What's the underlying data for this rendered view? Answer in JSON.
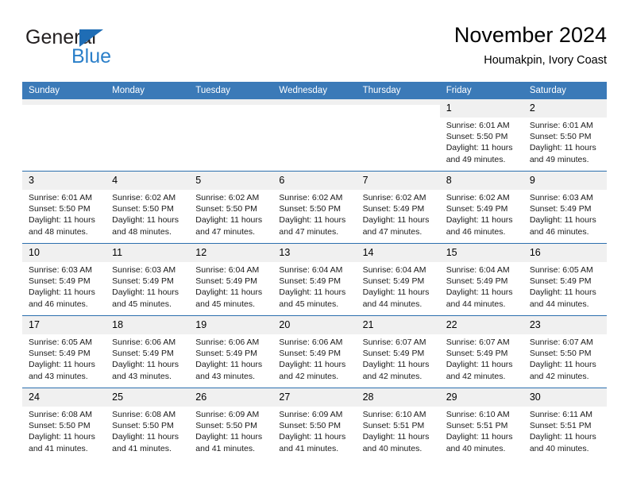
{
  "logo": {
    "text_primary": "General",
    "text_secondary": "Blue",
    "primary_color": "#231f20",
    "secondary_color": "#2a7fc9",
    "triangle_color": "#1f6db5",
    "icon": "blue-triangle-icon"
  },
  "header": {
    "title": "November 2024",
    "subtitle": "Houmakpin, Ivory Coast"
  },
  "theme": {
    "header_bg": "#3b7ab8",
    "header_text": "#ffffff",
    "row_divider": "#2c6fae",
    "daynum_bg": "#f0f0f0"
  },
  "calendar": {
    "weekday_headers": [
      "Sunday",
      "Monday",
      "Tuesday",
      "Wednesday",
      "Thursday",
      "Friday",
      "Saturday"
    ],
    "weeks": [
      [
        {
          "day": "",
          "empty": true
        },
        {
          "day": "",
          "empty": true
        },
        {
          "day": "",
          "empty": true
        },
        {
          "day": "",
          "empty": true
        },
        {
          "day": "",
          "empty": true
        },
        {
          "day": "1",
          "sunrise": "Sunrise: 6:01 AM",
          "sunset": "Sunset: 5:50 PM",
          "daylight": "Daylight: 11 hours and 49 minutes."
        },
        {
          "day": "2",
          "sunrise": "Sunrise: 6:01 AM",
          "sunset": "Sunset: 5:50 PM",
          "daylight": "Daylight: 11 hours and 49 minutes."
        }
      ],
      [
        {
          "day": "3",
          "sunrise": "Sunrise: 6:01 AM",
          "sunset": "Sunset: 5:50 PM",
          "daylight": "Daylight: 11 hours and 48 minutes."
        },
        {
          "day": "4",
          "sunrise": "Sunrise: 6:02 AM",
          "sunset": "Sunset: 5:50 PM",
          "daylight": "Daylight: 11 hours and 48 minutes."
        },
        {
          "day": "5",
          "sunrise": "Sunrise: 6:02 AM",
          "sunset": "Sunset: 5:50 PM",
          "daylight": "Daylight: 11 hours and 47 minutes."
        },
        {
          "day": "6",
          "sunrise": "Sunrise: 6:02 AM",
          "sunset": "Sunset: 5:50 PM",
          "daylight": "Daylight: 11 hours and 47 minutes."
        },
        {
          "day": "7",
          "sunrise": "Sunrise: 6:02 AM",
          "sunset": "Sunset: 5:49 PM",
          "daylight": "Daylight: 11 hours and 47 minutes."
        },
        {
          "day": "8",
          "sunrise": "Sunrise: 6:02 AM",
          "sunset": "Sunset: 5:49 PM",
          "daylight": "Daylight: 11 hours and 46 minutes."
        },
        {
          "day": "9",
          "sunrise": "Sunrise: 6:03 AM",
          "sunset": "Sunset: 5:49 PM",
          "daylight": "Daylight: 11 hours and 46 minutes."
        }
      ],
      [
        {
          "day": "10",
          "sunrise": "Sunrise: 6:03 AM",
          "sunset": "Sunset: 5:49 PM",
          "daylight": "Daylight: 11 hours and 46 minutes."
        },
        {
          "day": "11",
          "sunrise": "Sunrise: 6:03 AM",
          "sunset": "Sunset: 5:49 PM",
          "daylight": "Daylight: 11 hours and 45 minutes."
        },
        {
          "day": "12",
          "sunrise": "Sunrise: 6:04 AM",
          "sunset": "Sunset: 5:49 PM",
          "daylight": "Daylight: 11 hours and 45 minutes."
        },
        {
          "day": "13",
          "sunrise": "Sunrise: 6:04 AM",
          "sunset": "Sunset: 5:49 PM",
          "daylight": "Daylight: 11 hours and 45 minutes."
        },
        {
          "day": "14",
          "sunrise": "Sunrise: 6:04 AM",
          "sunset": "Sunset: 5:49 PM",
          "daylight": "Daylight: 11 hours and 44 minutes."
        },
        {
          "day": "15",
          "sunrise": "Sunrise: 6:04 AM",
          "sunset": "Sunset: 5:49 PM",
          "daylight": "Daylight: 11 hours and 44 minutes."
        },
        {
          "day": "16",
          "sunrise": "Sunrise: 6:05 AM",
          "sunset": "Sunset: 5:49 PM",
          "daylight": "Daylight: 11 hours and 44 minutes."
        }
      ],
      [
        {
          "day": "17",
          "sunrise": "Sunrise: 6:05 AM",
          "sunset": "Sunset: 5:49 PM",
          "daylight": "Daylight: 11 hours and 43 minutes."
        },
        {
          "day": "18",
          "sunrise": "Sunrise: 6:06 AM",
          "sunset": "Sunset: 5:49 PM",
          "daylight": "Daylight: 11 hours and 43 minutes."
        },
        {
          "day": "19",
          "sunrise": "Sunrise: 6:06 AM",
          "sunset": "Sunset: 5:49 PM",
          "daylight": "Daylight: 11 hours and 43 minutes."
        },
        {
          "day": "20",
          "sunrise": "Sunrise: 6:06 AM",
          "sunset": "Sunset: 5:49 PM",
          "daylight": "Daylight: 11 hours and 42 minutes."
        },
        {
          "day": "21",
          "sunrise": "Sunrise: 6:07 AM",
          "sunset": "Sunset: 5:49 PM",
          "daylight": "Daylight: 11 hours and 42 minutes."
        },
        {
          "day": "22",
          "sunrise": "Sunrise: 6:07 AM",
          "sunset": "Sunset: 5:49 PM",
          "daylight": "Daylight: 11 hours and 42 minutes."
        },
        {
          "day": "23",
          "sunrise": "Sunrise: 6:07 AM",
          "sunset": "Sunset: 5:50 PM",
          "daylight": "Daylight: 11 hours and 42 minutes."
        }
      ],
      [
        {
          "day": "24",
          "sunrise": "Sunrise: 6:08 AM",
          "sunset": "Sunset: 5:50 PM",
          "daylight": "Daylight: 11 hours and 41 minutes."
        },
        {
          "day": "25",
          "sunrise": "Sunrise: 6:08 AM",
          "sunset": "Sunset: 5:50 PM",
          "daylight": "Daylight: 11 hours and 41 minutes."
        },
        {
          "day": "26",
          "sunrise": "Sunrise: 6:09 AM",
          "sunset": "Sunset: 5:50 PM",
          "daylight": "Daylight: 11 hours and 41 minutes."
        },
        {
          "day": "27",
          "sunrise": "Sunrise: 6:09 AM",
          "sunset": "Sunset: 5:50 PM",
          "daylight": "Daylight: 11 hours and 41 minutes."
        },
        {
          "day": "28",
          "sunrise": "Sunrise: 6:10 AM",
          "sunset": "Sunset: 5:51 PM",
          "daylight": "Daylight: 11 hours and 40 minutes."
        },
        {
          "day": "29",
          "sunrise": "Sunrise: 6:10 AM",
          "sunset": "Sunset: 5:51 PM",
          "daylight": "Daylight: 11 hours and 40 minutes."
        },
        {
          "day": "30",
          "sunrise": "Sunrise: 6:11 AM",
          "sunset": "Sunset: 5:51 PM",
          "daylight": "Daylight: 11 hours and 40 minutes."
        }
      ]
    ]
  }
}
